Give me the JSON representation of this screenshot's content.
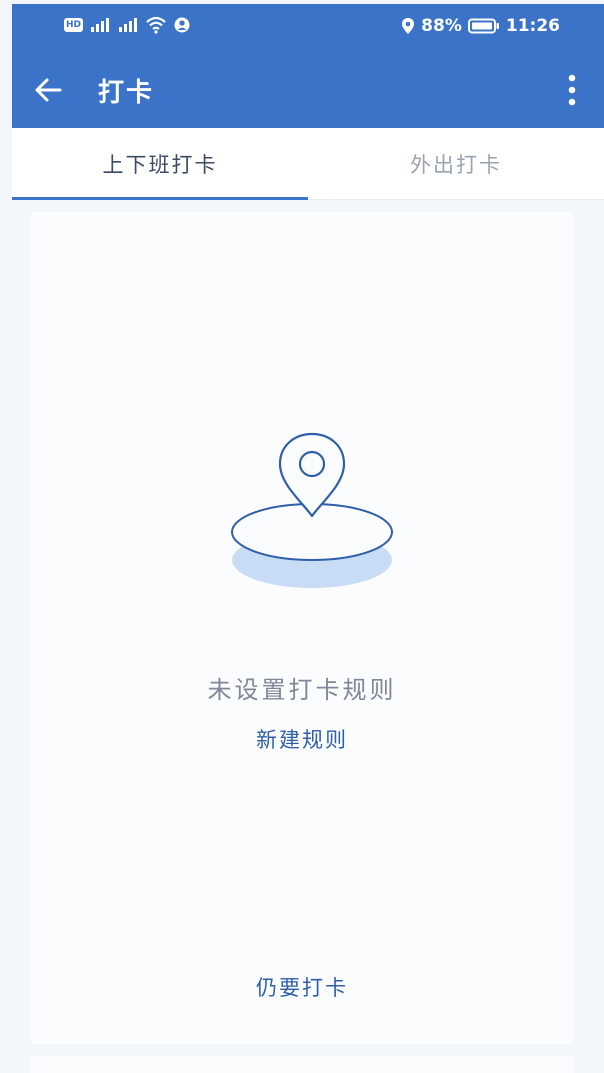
{
  "status_bar": {
    "hd_label": "HD",
    "battery": "88%",
    "time": "11:26",
    "icons": [
      "hd-icon",
      "signal-icon",
      "signal-icon",
      "wifi-icon",
      "hotspot-icon",
      "location-icon",
      "battery-icon"
    ]
  },
  "app_bar": {
    "title": "打卡",
    "back_icon": "arrow-left-icon",
    "more_icon": "more-vertical-icon"
  },
  "tabs": [
    {
      "label": "上下班打卡",
      "active": true
    },
    {
      "label": "外出打卡",
      "active": false
    }
  ],
  "empty_state": {
    "illustration_icon": "location-pin-icon",
    "message": "未设置打卡规则",
    "new_rule_link": "新建规则",
    "still_clock_link": "仍要打卡"
  },
  "colors": {
    "brand": "#3a73c8",
    "link": "#2f5fa8",
    "muted_text": "#7f8898",
    "background": "#f3f6fb"
  }
}
